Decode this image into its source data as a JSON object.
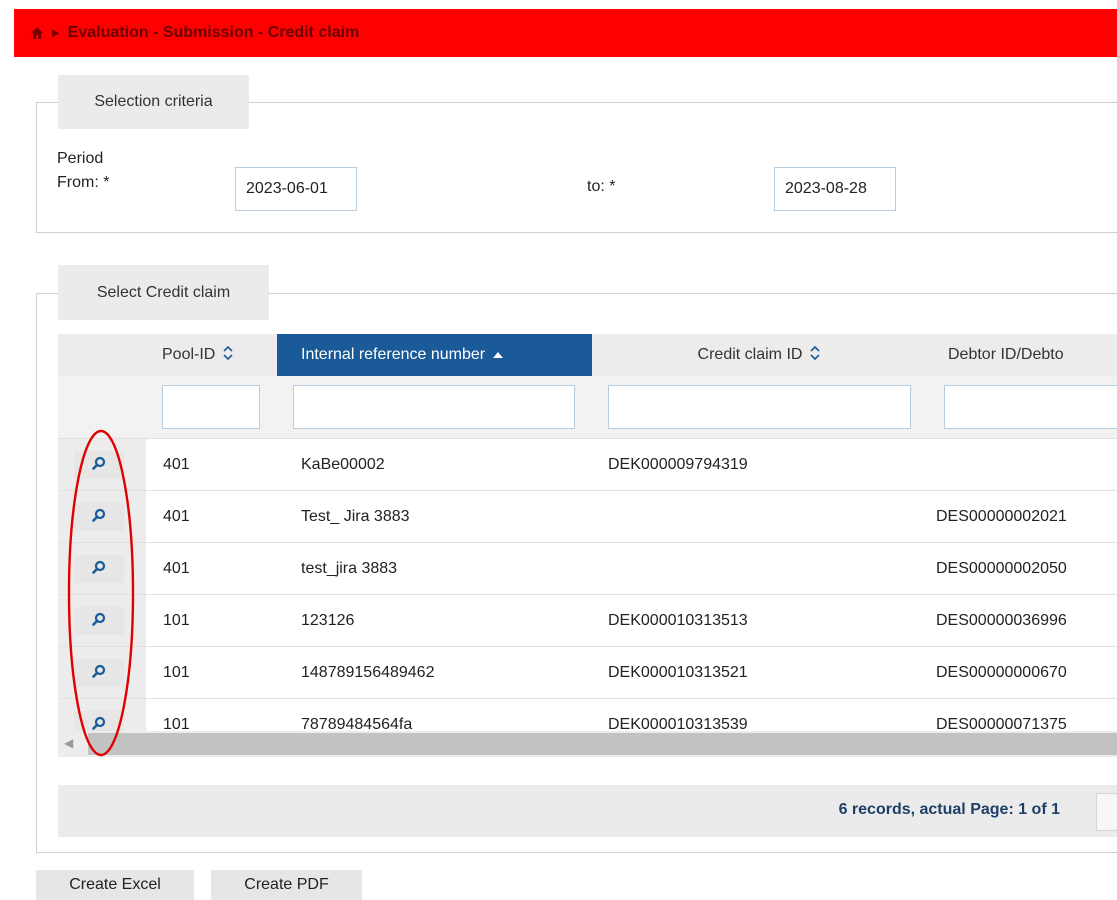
{
  "header": {
    "breadcrumb": "Evaluation - Submission - Credit claim",
    "icons": [
      "home-icon",
      "caret-right-icon"
    ],
    "bg_color": "#ff0000"
  },
  "criteria": {
    "legend": "Selection criteria",
    "period_label": "Period",
    "from_label": "From: *",
    "from_value": "2023-06-01",
    "to_label": "to: *",
    "to_value": "2023-08-28"
  },
  "select": {
    "legend": "Select Credit claim",
    "columns": [
      {
        "label": "Pool-ID",
        "sort": "sortable"
      },
      {
        "label": "Internal reference number",
        "sort": "ascending"
      },
      {
        "label": "Credit claim ID",
        "sort": "sortable"
      },
      {
        "label": "Debtor ID/Debto",
        "sort": "none"
      }
    ],
    "sortable_icon": "sort-both-icon",
    "asc_icon": "sort-asc-icon",
    "rows": [
      {
        "pool": "401",
        "ref": "KaBe00002",
        "claim": "DEK000009794319",
        "debtor": ""
      },
      {
        "pool": "401",
        "ref": "Test_ Jira 3883",
        "claim": "",
        "debtor": "DES00000002021"
      },
      {
        "pool": "401",
        "ref": "test_jira 3883",
        "claim": "",
        "debtor": "DES00000002050"
      },
      {
        "pool": "101",
        "ref": "123126",
        "claim": "DEK000010313513",
        "debtor": "DES00000036996"
      },
      {
        "pool": "101",
        "ref": "148789156489462",
        "claim": "DEK000010313521",
        "debtor": "DES00000000670"
      },
      {
        "pool": "101",
        "ref": "78789484564fa",
        "claim": "DEK000010313539",
        "debtor": "DES00000071375"
      }
    ],
    "row_icon": "magnifier-icon",
    "pager_text": "6 records, actual Page: 1 of 1",
    "accent_color": "#1a5a98",
    "annotation_color": "#e00000"
  },
  "buttons": {
    "excel": "Create Excel",
    "pdf": "Create PDF"
  }
}
